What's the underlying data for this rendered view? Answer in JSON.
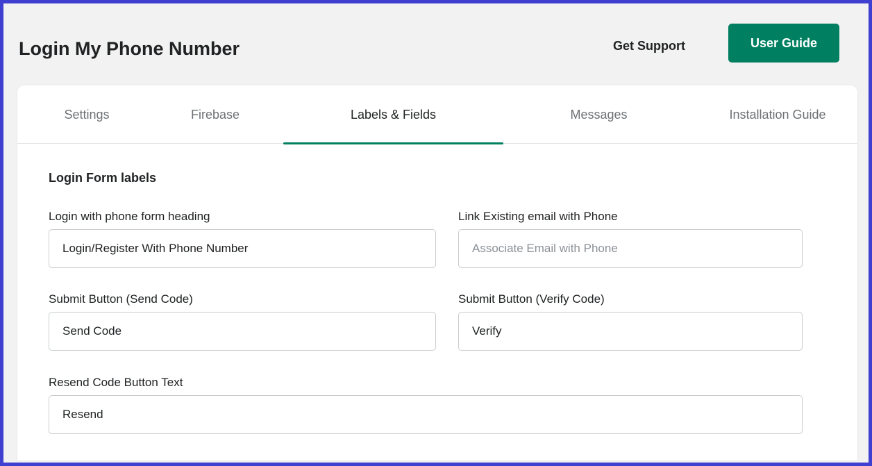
{
  "header": {
    "title": "Login My Phone Number",
    "support_label": "Get Support",
    "guide_label": "User Guide"
  },
  "tabs": [
    {
      "label": "Settings",
      "active": false
    },
    {
      "label": "Firebase",
      "active": false
    },
    {
      "label": "Labels & Fields",
      "active": true
    },
    {
      "label": "Messages",
      "active": false
    },
    {
      "label": "Installation Guide",
      "active": false
    }
  ],
  "form": {
    "section_title": "Login Form labels",
    "fields": [
      {
        "label": "Login with phone form heading",
        "value": "Login/Register With Phone Number",
        "placeholder": ""
      },
      {
        "label": "Link Existing email with Phone",
        "value": "",
        "placeholder": "Associate Email with Phone"
      },
      {
        "label": "Submit Button (Send Code)",
        "value": "Send Code",
        "placeholder": ""
      },
      {
        "label": "Submit Button (Verify Code)",
        "value": "Verify",
        "placeholder": ""
      },
      {
        "label": "Resend Code Button Text",
        "value": "Resend",
        "placeholder": ""
      }
    ]
  },
  "colors": {
    "accent": "#008060",
    "frame_border": "#4040d0",
    "page_background": "#f2f2f2"
  }
}
